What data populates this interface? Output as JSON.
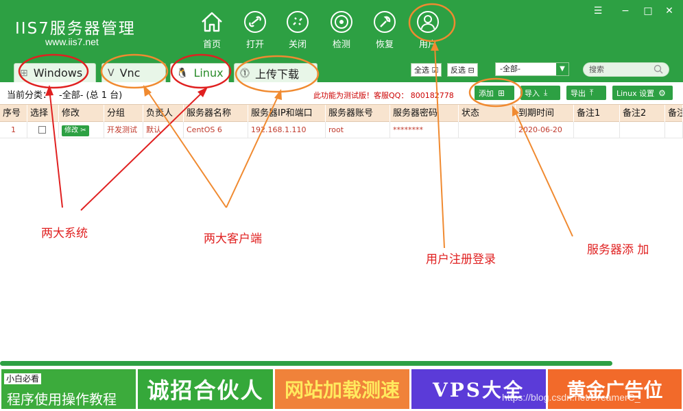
{
  "header": {
    "logo": "IIS7服务器管理",
    "url": "www.iis7.net",
    "nav": [
      {
        "label": "首页",
        "icon": "home-icon"
      },
      {
        "label": "打开",
        "icon": "link-icon"
      },
      {
        "label": "关闭",
        "icon": "unlink-icon"
      },
      {
        "label": "检测",
        "icon": "radar-icon"
      },
      {
        "label": "恢复",
        "icon": "wrench-icon"
      },
      {
        "label": "用户",
        "icon": "user-icon"
      }
    ]
  },
  "tabs": [
    {
      "label": "Windows",
      "icon": "windows-icon"
    },
    {
      "label": "Vnc",
      "icon": "vnc-icon"
    },
    {
      "label": "Linux",
      "icon": "linux-icon"
    },
    {
      "label": "上传下载",
      "icon": "upload-icon"
    }
  ],
  "filters": {
    "select_all": "全选",
    "invert": "反选",
    "category_value": "-全部-",
    "search_placeholder": "搜索"
  },
  "toolbar": {
    "category_label": "当前分类：",
    "category_value": "-全部- (总 1 台)",
    "notice": "此功能为测试版！客服QQ： 800182778",
    "add": "添加",
    "import": "导入",
    "export": "导出",
    "settings": "Linux 设置"
  },
  "table": {
    "columns": [
      "序号",
      "选择",
      "修改",
      "分组",
      "负责人",
      "服务器名称",
      "服务器IP和端口",
      "服务器账号",
      "服务器密码",
      "状态",
      "到期时间",
      "备注1",
      "备注2",
      "备注"
    ],
    "rows": [
      {
        "index": "1",
        "edit": "修改",
        "group": "开发测试",
        "owner": "默认",
        "name": "CentOS 6",
        "ip": "192.168.1.110",
        "account": "root",
        "password": "********",
        "status": "",
        "expire": "2020-06-20",
        "note1": "",
        "note2": ""
      }
    ]
  },
  "footer": {
    "b1_top": "小白必看",
    "b1_text": "程序使用操作教程",
    "b2": "诚招合伙人",
    "b3": "网站加载测速",
    "b4": "VPS大全",
    "b5": "黄金广告位",
    "watermark": "https://blog.csdn.net/DreamerC_"
  },
  "annotations": {
    "two_systems": "两大系统",
    "two_clients": "两大客户端",
    "user_register": "用户注册登录",
    "server_add": "服务器添 加"
  },
  "colors": {
    "brand_green": "#2da043",
    "annot_red": "#e02020",
    "annot_orange": "#f08a30"
  }
}
